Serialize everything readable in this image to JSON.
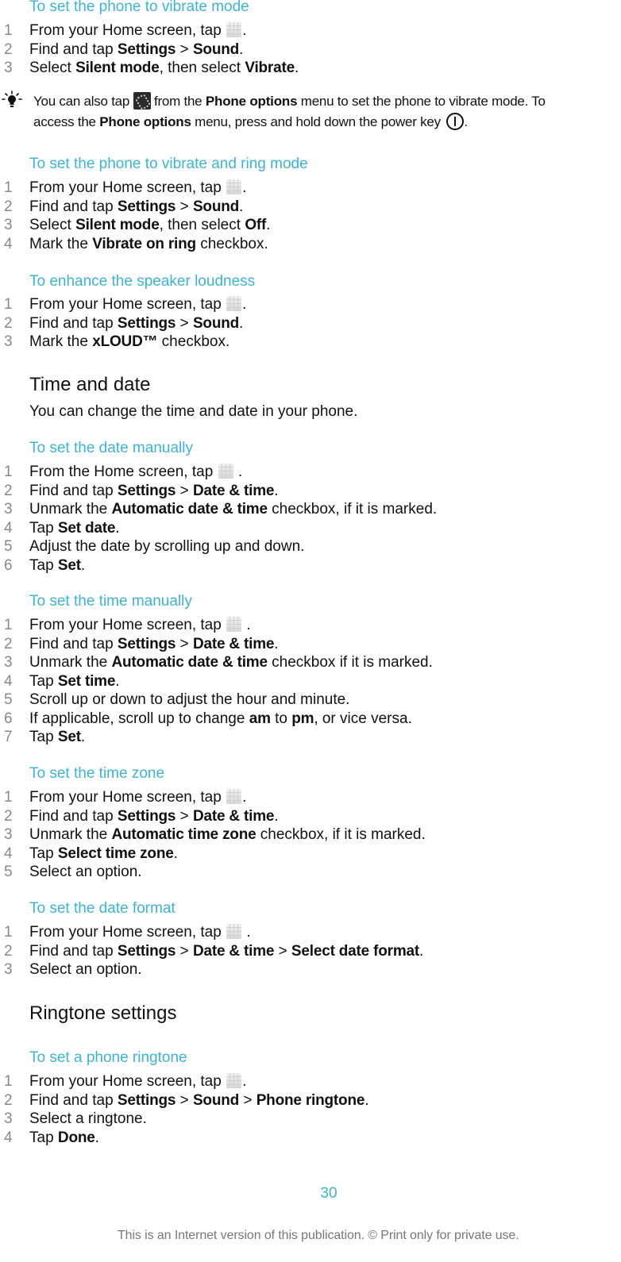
{
  "procedures": [
    {
      "title": "To set the phone to vibrate mode",
      "steps": [
        [
          {
            "t": "From your Home screen, tap "
          },
          {
            "icon": "app-grid"
          },
          {
            "t": "."
          }
        ],
        [
          {
            "t": "Find and tap "
          },
          {
            "b": "Settings"
          },
          {
            "t": " > "
          },
          {
            "b": "Sound"
          },
          {
            "t": "."
          }
        ],
        [
          {
            "t": "Select "
          },
          {
            "b": "Silent mode"
          },
          {
            "t": ", then select "
          },
          {
            "b": "Vibrate"
          },
          {
            "t": "."
          }
        ]
      ]
    },
    {
      "title": "To set the phone to vibrate and ring mode",
      "steps": [
        [
          {
            "t": "From your Home screen, tap "
          },
          {
            "icon": "app-grid"
          },
          {
            "t": "."
          }
        ],
        [
          {
            "t": "Find and tap "
          },
          {
            "b": "Settings"
          },
          {
            "t": " > "
          },
          {
            "b": "Sound"
          },
          {
            "t": "."
          }
        ],
        [
          {
            "t": "Select "
          },
          {
            "b": "Silent mode"
          },
          {
            "t": ", then select "
          },
          {
            "b": "Off"
          },
          {
            "t": "."
          }
        ],
        [
          {
            "t": "Mark the "
          },
          {
            "b": "Vibrate on ring"
          },
          {
            "t": " checkbox."
          }
        ]
      ]
    },
    {
      "title": "To enhance the speaker loudness",
      "steps": [
        [
          {
            "t": "From your Home screen, tap "
          },
          {
            "icon": "app-grid"
          },
          {
            "t": "."
          }
        ],
        [
          {
            "t": "Find and tap "
          },
          {
            "b": "Settings"
          },
          {
            "t": " > "
          },
          {
            "b": "Sound"
          },
          {
            "t": "."
          }
        ],
        [
          {
            "t": "Mark the "
          },
          {
            "b": "xLOUD™"
          },
          {
            "t": " checkbox."
          }
        ]
      ]
    },
    {
      "title": "To set the date manually",
      "steps": [
        [
          {
            "t": "From the Home screen, tap "
          },
          {
            "icon": "app-grid"
          },
          {
            "t": " ."
          }
        ],
        [
          {
            "t": "Find and tap "
          },
          {
            "b": "Settings"
          },
          {
            "t": " > "
          },
          {
            "b": "Date & time"
          },
          {
            "t": "."
          }
        ],
        [
          {
            "t": "Unmark the "
          },
          {
            "b": "Automatic date & time"
          },
          {
            "t": " checkbox, if it is marked."
          }
        ],
        [
          {
            "t": "Tap "
          },
          {
            "b": "Set date"
          },
          {
            "t": "."
          }
        ],
        [
          {
            "t": "Adjust the date by scrolling up and down."
          }
        ],
        [
          {
            "t": "Tap "
          },
          {
            "b": "Set"
          },
          {
            "t": "."
          }
        ]
      ]
    },
    {
      "title": "To set the time manually",
      "steps": [
        [
          {
            "t": "From your Home screen, tap "
          },
          {
            "icon": "app-grid"
          },
          {
            "t": " ."
          }
        ],
        [
          {
            "t": "Find and tap "
          },
          {
            "b": "Settings"
          },
          {
            "t": " > "
          },
          {
            "b": "Date & time"
          },
          {
            "t": "."
          }
        ],
        [
          {
            "t": "Unmark the "
          },
          {
            "b": "Automatic date & time"
          },
          {
            "t": " checkbox if it is marked."
          }
        ],
        [
          {
            "t": "Tap "
          },
          {
            "b": "Set time"
          },
          {
            "t": "."
          }
        ],
        [
          {
            "t": "Scroll up or down to adjust the hour and minute."
          }
        ],
        [
          {
            "t": "If applicable, scroll up to change "
          },
          {
            "b": "am"
          },
          {
            "t": " to "
          },
          {
            "b": "pm"
          },
          {
            "t": ", or vice versa."
          }
        ],
        [
          {
            "t": "Tap "
          },
          {
            "b": "Set"
          },
          {
            "t": "."
          }
        ]
      ]
    },
    {
      "title": "To set the time zone",
      "steps": [
        [
          {
            "t": "From your Home screen, tap "
          },
          {
            "icon": "app-grid"
          },
          {
            "t": "."
          }
        ],
        [
          {
            "t": "Find and tap "
          },
          {
            "b": "Settings"
          },
          {
            "t": " > "
          },
          {
            "b": "Date & time"
          },
          {
            "t": "."
          }
        ],
        [
          {
            "t": "Unmark the "
          },
          {
            "b": "Automatic time zone"
          },
          {
            "t": " checkbox, if it is marked."
          }
        ],
        [
          {
            "t": "Tap "
          },
          {
            "b": "Select time zone"
          },
          {
            "t": "."
          }
        ],
        [
          {
            "t": "Select an option."
          }
        ]
      ]
    },
    {
      "title": "To set the date format",
      "steps": [
        [
          {
            "t": "From your Home screen, tap "
          },
          {
            "icon": "app-grid"
          },
          {
            "t": " ."
          }
        ],
        [
          {
            "t": "Find and tap "
          },
          {
            "b": "Settings"
          },
          {
            "t": " > "
          },
          {
            "b": "Date & time"
          },
          {
            "t": " > "
          },
          {
            "b": "Select date format"
          },
          {
            "t": "."
          }
        ],
        [
          {
            "t": "Select an option."
          }
        ]
      ]
    },
    {
      "title": "To set a phone ringtone",
      "steps": [
        [
          {
            "t": "From your Home screen, tap "
          },
          {
            "icon": "app-grid"
          },
          {
            "t": "."
          }
        ],
        [
          {
            "t": "Find and tap "
          },
          {
            "b": "Settings"
          },
          {
            "t": " > "
          },
          {
            "b": "Sound"
          },
          {
            "t": " > "
          },
          {
            "b": "Phone ringtone"
          },
          {
            "t": "."
          }
        ],
        [
          {
            "t": "Select a ringtone."
          }
        ],
        [
          {
            "t": "Tap "
          },
          {
            "b": "Done"
          },
          {
            "t": "."
          }
        ]
      ]
    }
  ],
  "note": {
    "icon": "lightbulb-tip",
    "lines": [
      [
        {
          "t": "You can also tap "
        },
        {
          "icon": "vibrate"
        },
        {
          "t": " from the "
        },
        {
          "b": "Phone options"
        },
        {
          "t": " menu to set the phone to vibrate mode. To"
        }
      ],
      [
        {
          "t": "access the "
        },
        {
          "b": "Phone options"
        },
        {
          "t": " menu, press and hold down the power key "
        },
        {
          "icon": "power"
        },
        {
          "t": "."
        }
      ]
    ]
  },
  "sections": {
    "time_and_date": {
      "title": "Time and date",
      "intro": "You can change the time and date in your phone."
    },
    "ringtone_settings": {
      "title": "Ringtone settings"
    }
  },
  "page_number": "30",
  "footer": "This is an Internet version of this publication. © Print only for private use.",
  "colors": {
    "heading_accent": "#3bb4d6",
    "step_number": "#888888",
    "body_text": "#111111",
    "footer_text": "#777777"
  }
}
